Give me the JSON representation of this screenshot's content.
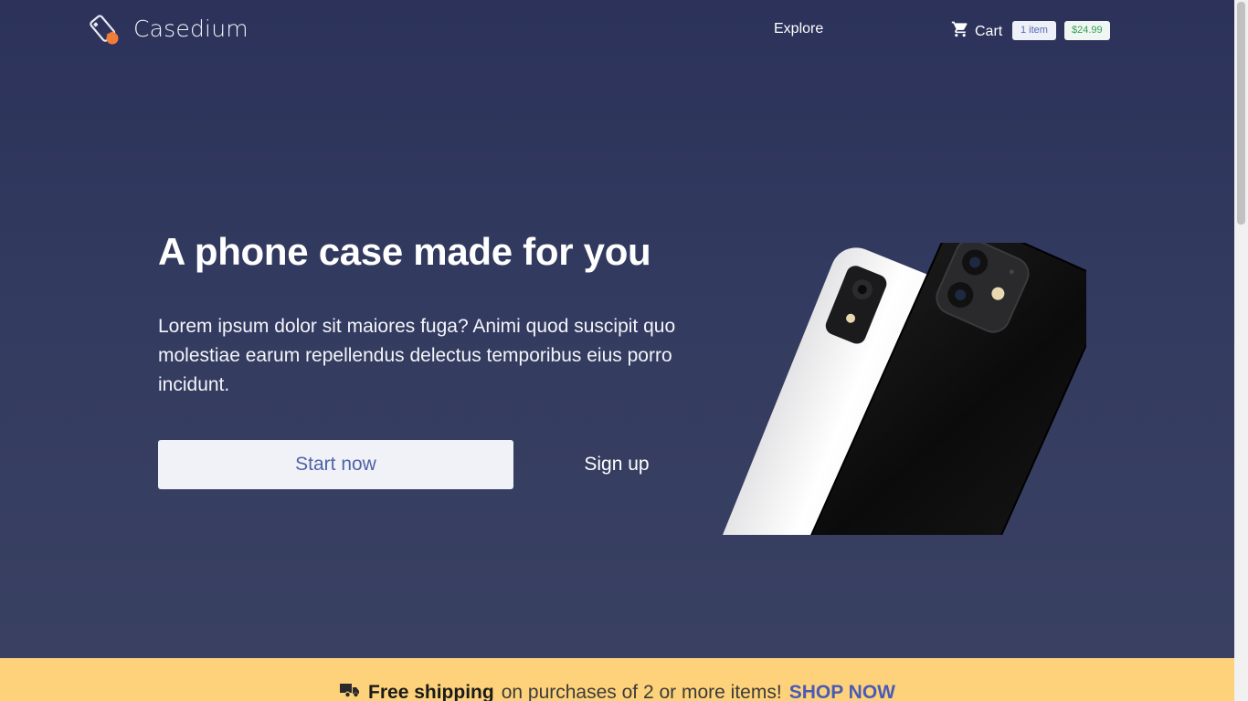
{
  "header": {
    "brand": "Casedium",
    "nav": {
      "explore": "Explore"
    },
    "cart": {
      "label": "Cart",
      "count_badge": "1 item",
      "total_badge": "$24.99"
    }
  },
  "hero": {
    "title": "A phone case made for you",
    "description": "Lorem ipsum dolor sit maiores fuga? Animi quod suscipit quo molestiae earum repellendus delectus temporibus eius porro incidunt.",
    "primary_button": "Start now",
    "secondary_button": "Sign up"
  },
  "promo": {
    "icon": "truck-icon",
    "strong": "Free shipping",
    "text": "on purchases of 2 or more items!",
    "link": "SHOP NOW"
  },
  "colors": {
    "background": "#2c325a",
    "promo_bar": "#fdd27a",
    "accent_link": "#4a5bb5",
    "price_badge_text": "#2f9e55",
    "logo_accent": "#f07c3c"
  }
}
